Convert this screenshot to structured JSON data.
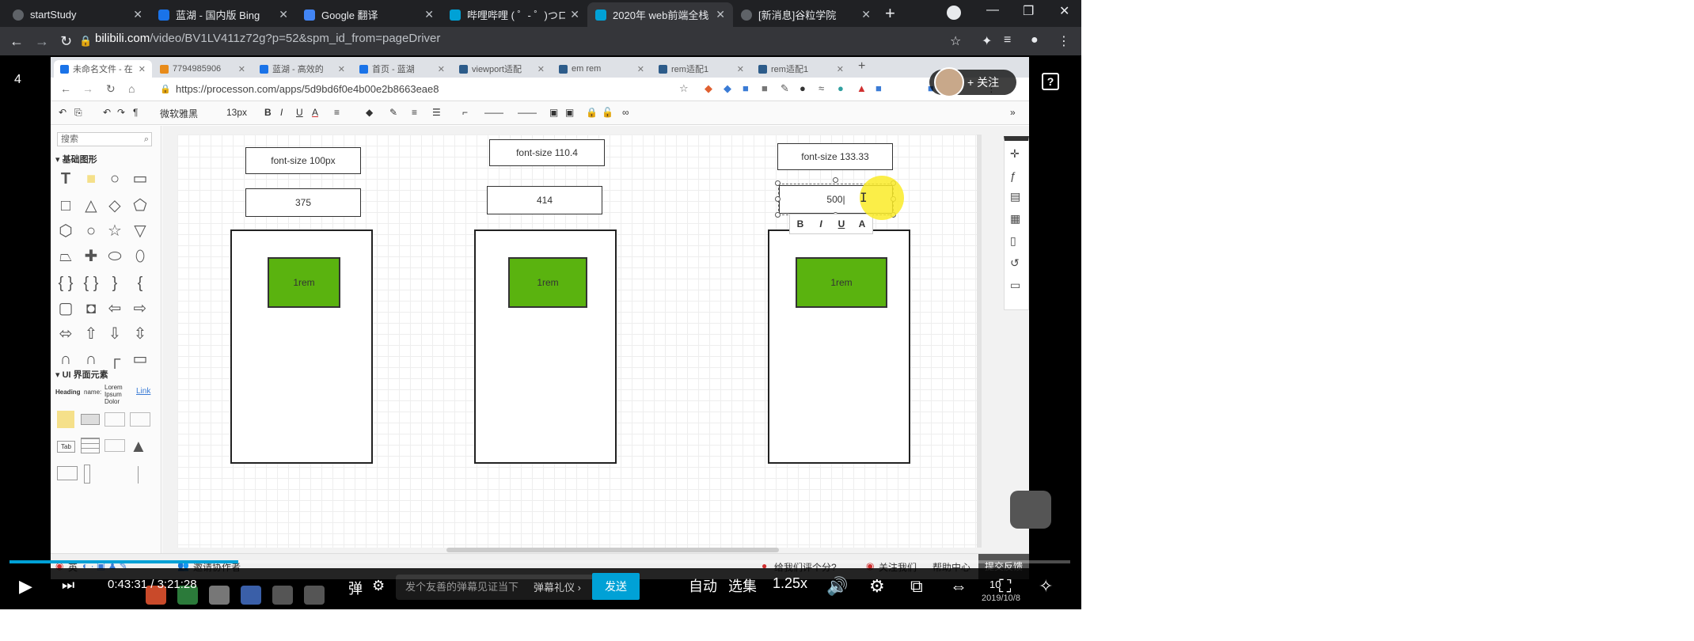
{
  "outer_tabs": [
    {
      "label": "startStudy",
      "fav": "#5f6368"
    },
    {
      "label": "蓝湖 - 国内版 Bing",
      "fav": "#1a73e8"
    },
    {
      "label": "Google 翻译",
      "fav": "#4285f4"
    },
    {
      "label": "哔哩哔哩 ( ゜- ゜)つロ",
      "fav": "#00a1d6"
    },
    {
      "label": "2020年 web前端全栈",
      "fav": "#00a1d6"
    },
    {
      "label": "[新消息]谷粒学院",
      "fav": "#5f6368"
    }
  ],
  "outer_url": {
    "domain": "bilibili.com",
    "path": "/video/BV1LV411z72g?p=52&spm_id_from=pageDriver"
  },
  "video": {
    "part_number": "4",
    "time_current": "0:43:31",
    "time_separator": "/",
    "time_total": "3:21:28",
    "progress_fraction": 0.216,
    "danmu_placeholder": "发个友善的弹幕见证当下",
    "danmu_etiquette": "弹幕礼仪 ›",
    "send_label": "发送",
    "auto_label": "自动",
    "episodes_label": "选集",
    "speed_label": "1.25x",
    "follow_label": "+ 关注",
    "date_label": "2019/10/8",
    "counter_label": "10"
  },
  "inner_tabs": [
    {
      "label": "未命名文件 - 在",
      "fav": "#1a73e8"
    },
    {
      "label": "7794985906",
      "fav": "#e88b1a"
    },
    {
      "label": "蓝湖 - 高效的",
      "fav": "#1a73e8"
    },
    {
      "label": "首页 - 蓝湖",
      "fav": "#1a73e8"
    },
    {
      "label": "viewport适配",
      "fav": "#2d5c8a"
    },
    {
      "label": "em rem",
      "fav": "#2d5c8a"
    },
    {
      "label": "rem适配1",
      "fav": "#2d5c8a"
    },
    {
      "label": "rem适配1",
      "fav": "#2d5c8a"
    }
  ],
  "inner_url": "https://processon.com/apps/5d9bd6f0e4b00e2b8663eae8",
  "editor": {
    "font_name": "微软雅黑",
    "font_size": "13px",
    "search_placeholder": "搜索",
    "section_basic": "基础图形",
    "section_ui": "UI 界面元素",
    "ui_heading": "Heading",
    "ui_name": "name:",
    "ui_lorem": "Lorem Ipsum Dolor",
    "ui_link": "Link",
    "ui_tab": "Tab",
    "invite_label": "邀请协作者",
    "rate_label": "给我们评个分?",
    "weibo_label": "关注我们",
    "help_label": "帮助中心",
    "feedback_label": "提交反馈",
    "ime_label": "英"
  },
  "diagram": {
    "columns": [
      {
        "font_label": "font-size 100px",
        "width_label": "375",
        "rem_label": "1rem"
      },
      {
        "font_label": "font-size 110.4",
        "width_label": "414",
        "rem_label": "1rem"
      },
      {
        "font_label": "font-size 133.33",
        "width_label": "500|",
        "rem_label": "1rem"
      }
    ],
    "fmt_buttons": [
      "B",
      "I",
      "U",
      "A"
    ]
  },
  "colors": {
    "accent": "#00a1d6",
    "green": "#5ab30f"
  }
}
